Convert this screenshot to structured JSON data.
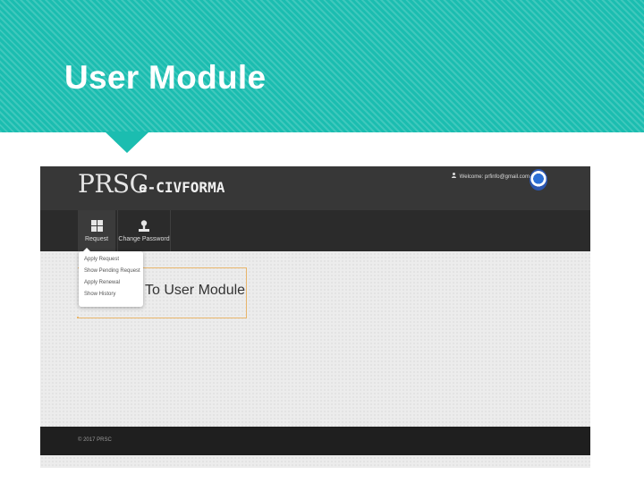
{
  "slide": {
    "title": "User Module"
  },
  "app": {
    "logo_main": "PRSC",
    "logo_sub": "e-CIVFORMA",
    "welcome_text": "Welcome: prfinfo@gmail.com",
    "welcome_caret": "▾",
    "nav": {
      "request_label": "Request",
      "change_password_label": "Change Password"
    },
    "dropdown": {
      "items": [
        "Apply Request",
        "Show Pending Request",
        "Apply Renewal",
        "Show History"
      ]
    },
    "welcome_panel_text": "To User Module",
    "footer_text": "© 2017 PRSC"
  },
  "colors": {
    "header_teal": "#1bbdb0",
    "topbar": "#373737",
    "navbar": "#2b2b2b",
    "footer": "#1f1f1f",
    "panel_border": "#e8b56b"
  },
  "icons": {
    "request": "grid-icon",
    "change_password": "user-icon",
    "welcome_user": "user-icon",
    "emblem": "emblem-logo"
  }
}
